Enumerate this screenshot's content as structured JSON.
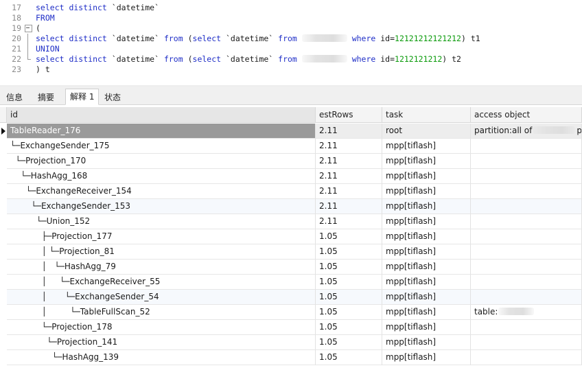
{
  "editor": {
    "lines": [
      {
        "no": "17",
        "fold": "none",
        "parts": [
          [
            "kw",
            "select distinct "
          ],
          [
            "t",
            "`datetime`"
          ]
        ]
      },
      {
        "no": "18",
        "fold": "none",
        "parts": [
          [
            "kw",
            "FROM"
          ]
        ]
      },
      {
        "no": "19",
        "fold": "box",
        "parts": [
          [
            "t",
            "("
          ]
        ]
      },
      {
        "no": "20",
        "fold": "line",
        "parts": [
          [
            "kw",
            "select distinct "
          ],
          [
            "t",
            "`datetime` "
          ],
          [
            "kw",
            "from "
          ],
          [
            "t",
            "("
          ],
          [
            "kw",
            "select "
          ],
          [
            "t",
            "`datetime` "
          ],
          [
            "kw",
            "from "
          ],
          [
            "blur",
            ""
          ],
          [
            "kw",
            " where "
          ],
          [
            "t",
            "id="
          ],
          [
            "num",
            "12121212121212"
          ],
          [
            "t",
            ") t1"
          ]
        ]
      },
      {
        "no": "21",
        "fold": "line",
        "parts": [
          [
            "kw",
            "UNION"
          ]
        ]
      },
      {
        "no": "22",
        "fold": "end",
        "parts": [
          [
            "kw",
            "select distinct "
          ],
          [
            "t",
            "`datetime` "
          ],
          [
            "kw",
            "from "
          ],
          [
            "t",
            "("
          ],
          [
            "kw",
            "select "
          ],
          [
            "t",
            "`datetime` "
          ],
          [
            "kw",
            "from "
          ],
          [
            "blur",
            ""
          ],
          [
            "kw",
            " where "
          ],
          [
            "t",
            "id="
          ],
          [
            "num",
            "1212121212"
          ],
          [
            "t",
            ") t2"
          ]
        ]
      },
      {
        "no": "23",
        "fold": "none",
        "parts": [
          [
            "t",
            ") t"
          ]
        ]
      }
    ]
  },
  "tabs": [
    {
      "label": "信息",
      "active": false
    },
    {
      "label": "摘要",
      "active": false
    },
    {
      "label": "解释 1",
      "active": true
    },
    {
      "label": "状态",
      "active": false
    }
  ],
  "grid": {
    "columns": [
      "id",
      "estRows",
      "task",
      "access object"
    ],
    "rows": [
      {
        "id": "TableReader_176",
        "estRows": "2.11",
        "task": "root",
        "access": "partition:all of",
        "access_blur": true,
        "access_tail": "pa",
        "selected": true
      },
      {
        "id": "└─ExchangeSender_175",
        "estRows": "2.11",
        "task": "mpp[tiflash]",
        "access": ""
      },
      {
        "id": "  └─Projection_170",
        "estRows": "2.11",
        "task": "mpp[tiflash]",
        "access": ""
      },
      {
        "id": "    └─HashAgg_168",
        "estRows": "2.11",
        "task": "mpp[tiflash]",
        "access": ""
      },
      {
        "id": "      └─ExchangeReceiver_154",
        "estRows": "2.11",
        "task": "mpp[tiflash]",
        "access": ""
      },
      {
        "id": "        └─ExchangeSender_153",
        "estRows": "2.11",
        "task": "mpp[tiflash]",
        "access": ""
      },
      {
        "id": "          └─Union_152",
        "estRows": "2.11",
        "task": "mpp[tiflash]",
        "access": ""
      },
      {
        "id": "            ├─Projection_177",
        "estRows": "1.05",
        "task": "mpp[tiflash]",
        "access": ""
      },
      {
        "id": "            │ └─Projection_81",
        "estRows": "1.05",
        "task": "mpp[tiflash]",
        "access": ""
      },
      {
        "id": "            │   └─HashAgg_79",
        "estRows": "1.05",
        "task": "mpp[tiflash]",
        "access": ""
      },
      {
        "id": "            │     └─ExchangeReceiver_55",
        "estRows": "1.05",
        "task": "mpp[tiflash]",
        "access": ""
      },
      {
        "id": "            │       └─ExchangeSender_54",
        "estRows": "1.05",
        "task": "mpp[tiflash]",
        "access": ""
      },
      {
        "id": "            │         └─TableFullScan_52",
        "estRows": "1.05",
        "task": "mpp[tiflash]",
        "access": "table:",
        "access_blur": true,
        "access_tail": ""
      },
      {
        "id": "            └─Projection_178",
        "estRows": "1.05",
        "task": "mpp[tiflash]",
        "access": ""
      },
      {
        "id": "              └─Projection_141",
        "estRows": "1.05",
        "task": "mpp[tiflash]",
        "access": ""
      },
      {
        "id": "                └─HashAgg_139",
        "estRows": "1.05",
        "task": "mpp[tiflash]",
        "access": ""
      }
    ]
  },
  "colors": {
    "keyword": "#1f2ec7",
    "number": "#0a9a0a",
    "selected_id_bg": "#9a9a9a"
  }
}
